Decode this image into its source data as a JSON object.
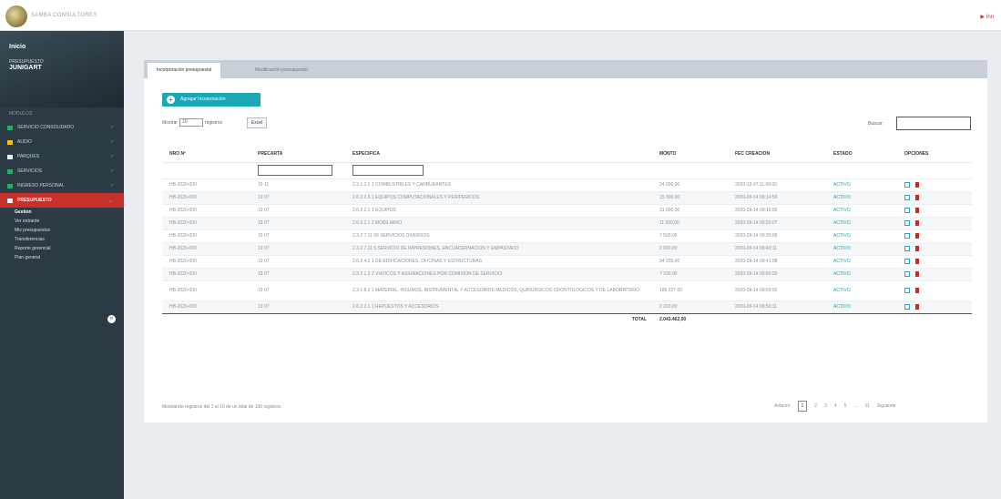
{
  "header": {
    "app_name": "SAMBA CONSULTORES",
    "user_flag": "▶ Inn"
  },
  "sidebar": {
    "brand_line1": "Inicio",
    "brand_line2": "PRESUPUESTO",
    "brand_line3": "JUNIGART",
    "section": "MODULOS",
    "items": [
      {
        "label": "SERVICIO CONSOLIDADO",
        "color": "#27ae60"
      },
      {
        "label": "AUDIO",
        "color": "#f1c40f"
      },
      {
        "label": "PARQUES",
        "color": "#ecf0f1"
      },
      {
        "label": "SERVICIOS",
        "color": "#27ae60"
      },
      {
        "label": "INGRESO PERSONAL",
        "color": "#27ae60"
      },
      {
        "label": "PRESUPUESTO",
        "color": "#ffffff"
      }
    ],
    "subitems": [
      "Gestion",
      "Ver entrante",
      "Mis presupuestos",
      "Transferencias",
      "Reporte gerencial",
      "Plan general"
    ]
  },
  "tabs": {
    "active": "Incorporación presupuestal",
    "inactive": "Modificación presupuestal"
  },
  "toolbar": {
    "add_label": "Agregar Incorporación",
    "show_prefix": "Mostrar",
    "show_value": "10",
    "show_suffix": "registros",
    "excel_label": "Excel",
    "search_label": "Buscar:"
  },
  "table": {
    "headers": [
      "NRO Nº",
      "PRECARTA",
      "ESPECIFICA",
      "MONTO",
      "FEC CREACION",
      "ESTADO",
      "OPCIONES"
    ],
    "rows": [
      {
        "nro": "HB-2020-000",
        "pre": "19 11",
        "esp": "2.3.1 2.1 1 COMBUSTIBLES Y CARBURANTES",
        "monto": "24 000,00",
        "fecha": "2020-12-07 11:00:00",
        "estado": "ACTIVO"
      },
      {
        "nro": "HB-2020-000",
        "pre": "19 07",
        "esp": "2.6.3 2.9 1 EQUIPOS COMPUTACIONALES Y PERIFERICOS",
        "monto": "15 000,00",
        "fecha": "2020-09-14 09:14:50",
        "estado": "ACTIVO"
      },
      {
        "nro": "HB-2020-000",
        "pre": "19 07",
        "esp": "2.6.3 2.1 1 EQUIPOS",
        "monto": "31 800,00",
        "fecha": "2020-09-14 09:15:00",
        "estado": "ACTIVO"
      },
      {
        "nro": "HB-2020-000",
        "pre": "19 07",
        "esp": "2.6.3 2.1 2 MOBILIARIO",
        "monto": "11 000,00",
        "fecha": "2020-09-14 09:20:07",
        "estado": "ACTIVO"
      },
      {
        "nro": "HB-2020-000",
        "pre": "19 07",
        "esp": "2.3.2 7.11 99 SERVICIOS DIVERSOS",
        "monto": "7 500,00",
        "fecha": "2020-09-14 09:30:05",
        "estado": "ACTIVO"
      },
      {
        "nro": "HB-2020-000",
        "pre": "19 07",
        "esp": "2.3.2 7.11 5 SERVICIO DE IMPRESIONES, ENCUADERNACION Y EMPASTADO",
        "monto": "2 000,00",
        "fecha": "2020-09-14 09:40:11",
        "estado": "ACTIVO"
      },
      {
        "nro": "HB-2020-000",
        "pre": "19 07",
        "esp": "2.6.2 4.2 1 DE EDIFICACIONES, OFICINAS Y ESTRUCTURAS",
        "monto": "94 225,00",
        "fecha": "2020-09-14 09:41:08",
        "estado": "ACTIVO"
      },
      {
        "nro": "HB-2020-000",
        "pre": "19 07",
        "esp": "2.3.2 1.2 2 VIATICOS Y ASIGNACIONES POR COMISION DE SERVICIO",
        "monto": "7 200,00",
        "fecha": "2020-09-14 09:50:30",
        "estado": "ACTIVO"
      },
      {
        "nro": "HB-2020-000",
        "pre": "19 07",
        "esp": "2.3.1 8.2 1 MATERIAL, INSUMOS, INSTRUMENTAL Y ACCESORIOS MEDICOS, QUIRURGICOS ODONTOLOGICOS Y DE LABORATORIO",
        "monto": "185 227,00",
        "fecha": "2020-09-14 09:59:02",
        "estado": "ACTIVO",
        "tall": true
      },
      {
        "nro": "HB-2020-000",
        "pre": "19 07",
        "esp": "2.6.3 2.1 1 REPUESTOS Y ACCESORIOS",
        "monto": "2 200,00",
        "fecha": "2020-09-14 09:59:11",
        "estado": "ACTIVO"
      }
    ],
    "total_label": "TOTAL",
    "total_value": "2.043.462,00"
  },
  "footer": {
    "info": "Mostrando registros del 1 al 10 de un total de 106 registros",
    "pager": [
      "Anterior",
      "1",
      "2",
      "3",
      "4",
      "5",
      "...",
      "11",
      "Siguiente"
    ]
  }
}
